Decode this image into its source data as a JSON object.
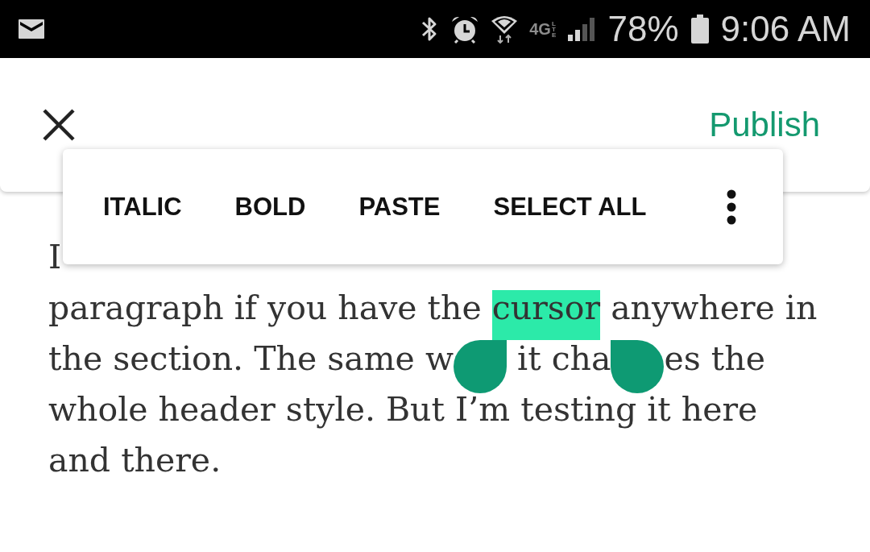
{
  "status_bar": {
    "network": "4G",
    "network_sub": "LTE",
    "battery": "78%",
    "time": "9:06 AM"
  },
  "app_bar": {
    "action": "Publish"
  },
  "text_toolbar": {
    "actions": [
      "ITALIC",
      "BOLD",
      "PASTE",
      "SELECT ALL"
    ]
  },
  "editor": {
    "lines": [
      [
        {
          "kind": "text",
          "text": "I",
          "selected": false
        }
      ],
      [
        {
          "kind": "text",
          "text": "paragraph if you have the ",
          "selected": false
        },
        {
          "kind": "text",
          "text": "cursor",
          "selected": true
        },
        {
          "kind": "text",
          "text": " anywhere in",
          "selected": false
        }
      ],
      [
        {
          "kind": "text",
          "text": "the section. The same w",
          "selected": false
        },
        {
          "kind": "start_handle"
        },
        {
          "kind": "text",
          "text": " it cha",
          "selected": false
        },
        {
          "kind": "end_handle"
        },
        {
          "kind": "text",
          "text": "es the",
          "selected": false
        }
      ],
      [
        {
          "kind": "text",
          "text": "whole header style. But I’m testing it here",
          "selected": false
        }
      ],
      [
        {
          "kind": "text",
          "text": "and there.",
          "selected": false
        }
      ]
    ]
  }
}
